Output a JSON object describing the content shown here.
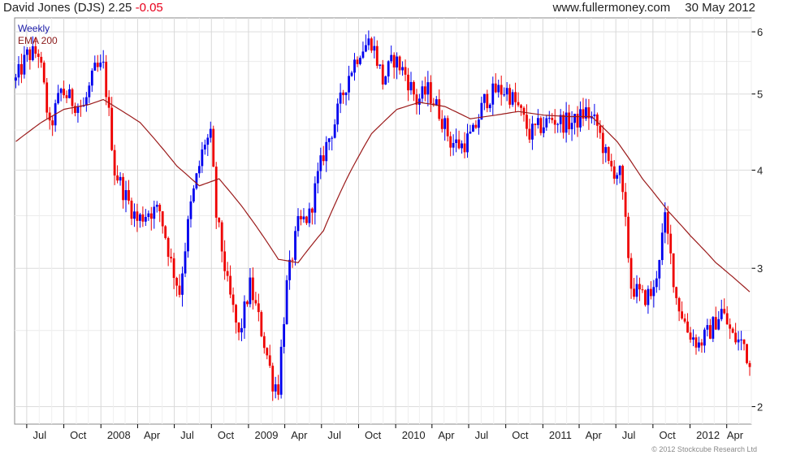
{
  "header": {
    "title_prefix": "David Jones (DJS) 2.25",
    "change": "-0.05",
    "site": "www.fullermoney.com",
    "date": "30 May 2012"
  },
  "legend": {
    "weekly": "Weekly",
    "ema": "EMA 200"
  },
  "copyright": "© 2012 Stockcube Research Ltd",
  "colors": {
    "up": "#0000ee",
    "down": "#ee0000",
    "ema": "#9b1b1b",
    "grid": "#dcdcdc",
    "axis": "#000000"
  },
  "chart_data": {
    "type": "candlestick",
    "scale": "log",
    "ylim": [
      1.9,
      6.25
    ],
    "y_ticks": [
      2,
      3,
      4,
      5,
      6
    ],
    "x_ticks": [
      "Jul",
      "Oct",
      "2008",
      "Apr",
      "Jul",
      "Oct",
      "2009",
      "Apr",
      "Jul",
      "Oct",
      "2010",
      "Apr",
      "Jul",
      "Oct",
      "2011",
      "Apr",
      "Jul",
      "Oct",
      "2012",
      "Apr"
    ],
    "x_range": [
      "2007-06",
      "2012-06"
    ],
    "close_anchors": [
      [
        "2007-06-04",
        5.2
      ],
      [
        "2007-07-02",
        5.6
      ],
      [
        "2007-07-30",
        5.65
      ],
      [
        "2007-08-27",
        4.5
      ],
      [
        "2007-09-24",
        5.05
      ],
      [
        "2007-10-22",
        4.9
      ],
      [
        "2007-11-19",
        4.8
      ],
      [
        "2007-12-17",
        5.35
      ],
      [
        "2008-01-07",
        5.4
      ],
      [
        "2008-02-04",
        4.0
      ],
      [
        "2008-03-03",
        3.7
      ],
      [
        "2008-03-31",
        3.45
      ],
      [
        "2008-04-28",
        3.55
      ],
      [
        "2008-05-26",
        3.55
      ],
      [
        "2008-06-23",
        3.05
      ],
      [
        "2008-07-14",
        2.8
      ],
      [
        "2008-08-11",
        3.6
      ],
      [
        "2008-09-15",
        4.35
      ],
      [
        "2008-09-29",
        4.4
      ],
      [
        "2008-10-13",
        3.5
      ],
      [
        "2008-11-10",
        2.85
      ],
      [
        "2008-12-08",
        2.45
      ],
      [
        "2009-01-05",
        2.85
      ],
      [
        "2009-02-02",
        2.5
      ],
      [
        "2009-03-02",
        2.15
      ],
      [
        "2009-03-16",
        2.12
      ],
      [
        "2009-04-06",
        2.85
      ],
      [
        "2009-05-04",
        3.4
      ],
      [
        "2009-06-01",
        3.5
      ],
      [
        "2009-07-06",
        4.2
      ],
      [
        "2009-08-03",
        4.6
      ],
      [
        "2009-09-07",
        5.3
      ],
      [
        "2009-10-05",
        5.7
      ],
      [
        "2009-11-02",
        5.85
      ],
      [
        "2009-11-30",
        5.2
      ],
      [
        "2009-12-28",
        5.55
      ],
      [
        "2010-01-25",
        5.3
      ],
      [
        "2010-02-22",
        4.9
      ],
      [
        "2010-03-22",
        5.05
      ],
      [
        "2010-04-19",
        4.75
      ],
      [
        "2010-05-17",
        4.35
      ],
      [
        "2010-06-14",
        4.3
      ],
      [
        "2010-07-12",
        4.45
      ],
      [
        "2010-08-09",
        4.9
      ],
      [
        "2010-09-06",
        5.05
      ],
      [
        "2010-10-04",
        5.05
      ],
      [
        "2010-11-01",
        4.8
      ],
      [
        "2010-11-29",
        4.45
      ],
      [
        "2010-12-27",
        4.55
      ],
      [
        "2011-01-24",
        4.65
      ],
      [
        "2011-02-21",
        4.6
      ],
      [
        "2011-03-21",
        4.6
      ],
      [
        "2011-04-18",
        4.75
      ],
      [
        "2011-05-16",
        4.55
      ],
      [
        "2011-06-13",
        4.05
      ],
      [
        "2011-07-11",
        3.95
      ],
      [
        "2011-08-08",
        2.85
      ],
      [
        "2011-09-05",
        2.75
      ],
      [
        "2011-10-03",
        2.8
      ],
      [
        "2011-10-31",
        3.45
      ],
      [
        "2011-11-28",
        2.75
      ],
      [
        "2011-12-26",
        2.5
      ],
      [
        "2012-01-23",
        2.4
      ],
      [
        "2012-02-20",
        2.5
      ],
      [
        "2012-03-19",
        2.65
      ],
      [
        "2012-04-16",
        2.45
      ],
      [
        "2012-05-14",
        2.4
      ],
      [
        "2012-05-28",
        2.25
      ]
    ],
    "ema200_anchors": [
      [
        "2007-06-04",
        4.35
      ],
      [
        "2007-08-06",
        4.6
      ],
      [
        "2007-10-01",
        4.78
      ],
      [
        "2007-12-03",
        4.85
      ],
      [
        "2008-01-07",
        4.92
      ],
      [
        "2008-04-07",
        4.6
      ],
      [
        "2008-07-07",
        4.05
      ],
      [
        "2008-09-01",
        3.82
      ],
      [
        "2008-10-20",
        3.9
      ],
      [
        "2008-12-15",
        3.6
      ],
      [
        "2009-03-16",
        3.08
      ],
      [
        "2009-05-04",
        3.05
      ],
      [
        "2009-07-06",
        3.35
      ],
      [
        "2009-09-07",
        3.95
      ],
      [
        "2009-11-02",
        4.45
      ],
      [
        "2010-01-04",
        4.78
      ],
      [
        "2010-03-01",
        4.88
      ],
      [
        "2010-05-03",
        4.82
      ],
      [
        "2010-07-05",
        4.65
      ],
      [
        "2010-09-06",
        4.7
      ],
      [
        "2010-11-01",
        4.75
      ],
      [
        "2011-01-03",
        4.7
      ],
      [
        "2011-03-07",
        4.68
      ],
      [
        "2011-05-02",
        4.68
      ],
      [
        "2011-07-04",
        4.35
      ],
      [
        "2011-09-05",
        3.9
      ],
      [
        "2011-11-07",
        3.55
      ],
      [
        "2012-01-02",
        3.3
      ],
      [
        "2012-03-05",
        3.05
      ],
      [
        "2012-05-28",
        2.8
      ]
    ]
  }
}
